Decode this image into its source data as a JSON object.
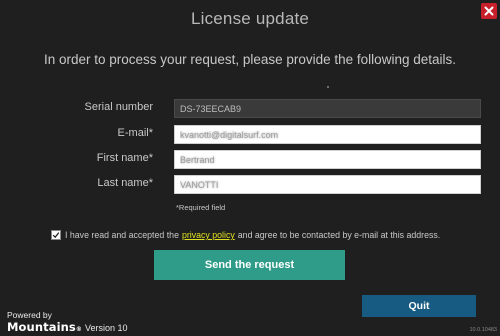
{
  "dialog": {
    "title": "License update",
    "intro": "In order to process your request, please provide the following details.",
    "close_icon": "close-x-icon",
    "close_color": "#c8202a"
  },
  "form": {
    "fields": [
      {
        "label": "Serial number",
        "value": "DS-73EECAB9",
        "editable": false
      },
      {
        "label": "E-mail*",
        "value": "kvanotti@digitalsurf.com",
        "editable": true
      },
      {
        "label": "First name*",
        "value": "Bertrand",
        "editable": true
      },
      {
        "label": "Last name*",
        "value": "VANOTTI",
        "editable": true
      }
    ],
    "required_note": "*Required field"
  },
  "consent": {
    "checked": true,
    "before": "I have read and accepted the",
    "link": "privacy policy",
    "after": "and agree to be contacted by e-mail at this address."
  },
  "buttons": {
    "send": "Send the request",
    "quit": "Quit"
  },
  "branding": {
    "powered_by": "Powered by",
    "logo": "Mountains",
    "version": "Version 10",
    "build": "10.0.10483"
  },
  "colors": {
    "background": "#1f1f1f",
    "send_button": "#2e9c88",
    "quit_button": "#175a82",
    "link": "#e0e020"
  }
}
